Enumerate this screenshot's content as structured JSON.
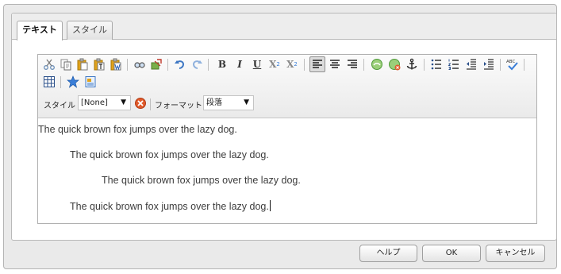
{
  "tabs": [
    {
      "label": "テキスト",
      "active": true
    },
    {
      "label": "スタイル",
      "active": false
    }
  ],
  "toolbar": {
    "row1": [
      {
        "name": "cut-icon"
      },
      {
        "name": "copy-icon"
      },
      {
        "name": "paste-icon"
      },
      {
        "name": "paste-text-icon"
      },
      {
        "name": "paste-word-icon"
      },
      {
        "name": "find-icon"
      },
      {
        "name": "replace-icon"
      },
      {
        "name": "undo-icon"
      },
      {
        "name": "redo-icon"
      },
      {
        "name": "bold-icon"
      },
      {
        "name": "italic-icon"
      },
      {
        "name": "underline-icon"
      },
      {
        "name": "subscript-icon"
      },
      {
        "name": "superscript-icon"
      },
      {
        "name": "align-left-icon"
      },
      {
        "name": "align-center-icon"
      },
      {
        "name": "align-right-icon"
      },
      {
        "name": "link-icon"
      },
      {
        "name": "unlink-icon"
      },
      {
        "name": "anchor-icon"
      },
      {
        "name": "bullet-list-icon"
      },
      {
        "name": "numbered-list-icon"
      },
      {
        "name": "outdent-icon"
      },
      {
        "name": "indent-icon"
      },
      {
        "name": "spellcheck-icon"
      }
    ],
    "row2": [
      {
        "name": "table-icon"
      },
      {
        "name": "special-char-icon"
      },
      {
        "name": "image-icon"
      }
    ],
    "bold_glyph": "B",
    "italic_glyph": "I",
    "underline_glyph": "U",
    "subscript_glyph": "X",
    "subscript_mark": "2",
    "superscript_glyph": "X",
    "superscript_mark": "2"
  },
  "style_bar": {
    "style_label": "スタイル",
    "style_value": "[None]",
    "format_label": "フォーマット",
    "format_value": "段落",
    "arrow": "▼"
  },
  "content": {
    "paragraphs": [
      {
        "text": "The quick brown fox jumps over the lazy dog.",
        "indent_level": 0
      },
      {
        "text": "The quick brown fox jumps over the lazy dog.",
        "indent_level": 1
      },
      {
        "text": "The quick brown fox jumps over the lazy dog.",
        "indent_level": 2
      },
      {
        "text": "The quick brown fox jumps over the lazy dog.",
        "indent_level": 1
      }
    ]
  },
  "buttons": {
    "help": "ヘルプ",
    "ok": "OK",
    "cancel": "キャンセル"
  },
  "colors": {
    "link_icon": "#4f9a3a",
    "clear_icon": "#e05a2b",
    "anchor_icon": "#2c2c2c",
    "star_icon": "#3a7ed8",
    "undo_icon": "#3f78c4",
    "paste_icon": "#e0a21a"
  }
}
